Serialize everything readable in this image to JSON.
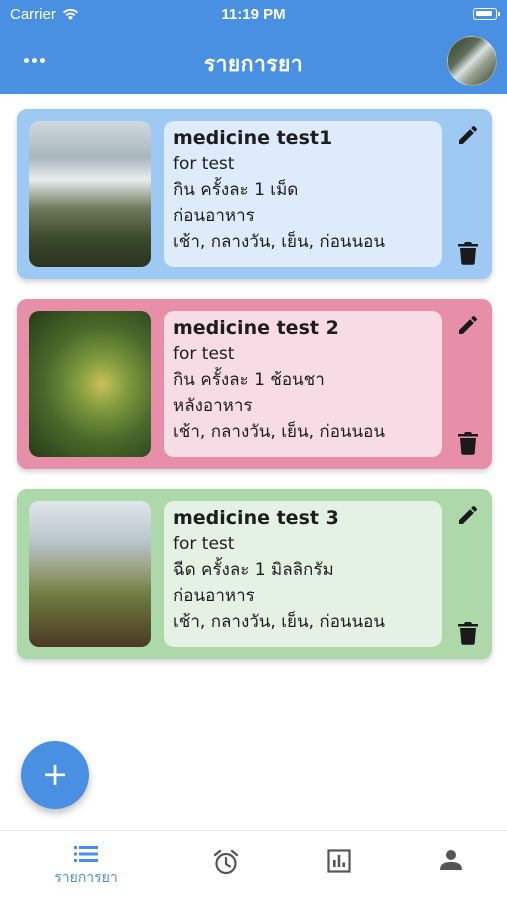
{
  "status_bar": {
    "carrier": "Carrier",
    "time": "11:19 PM"
  },
  "header": {
    "title": "รายการยา"
  },
  "medicines": [
    {
      "name": "medicine test1",
      "description": "for test",
      "dosage": "กิน ครั้งละ 1 เม็ด",
      "timing": "ก่อนอาหาร",
      "schedule": "เช้า, กลางวัน, เย็น, ก่อนนอน",
      "accent": "#9ec9f3"
    },
    {
      "name": "medicine test 2",
      "description": "for test",
      "dosage": "กิน ครั้งละ 1 ช้อนชา",
      "timing": "หลังอาหาร",
      "schedule": "เช้า, กลางวัน, เย็น, ก่อนนอน",
      "accent": "#e78ea8"
    },
    {
      "name": "medicine test 3",
      "description": "for test",
      "dosage": "ฉีด ครั้งละ 1 มิลลิกรัม",
      "timing": "ก่อนอาหาร",
      "schedule": "เช้า, กลางวัน, เย็น, ก่อนนอน",
      "accent": "#acd8aa"
    }
  ],
  "fab": {
    "icon": "plus-icon",
    "label": "+"
  },
  "bottom_nav": {
    "items": [
      {
        "icon": "list-icon",
        "label": "รายการยา",
        "active": true
      },
      {
        "icon": "alarm-icon",
        "label": "",
        "active": false
      },
      {
        "icon": "chart-icon",
        "label": "",
        "active": false
      },
      {
        "icon": "person-icon",
        "label": "",
        "active": false
      }
    ]
  },
  "colors": {
    "primary": "#4a90e2",
    "inactive_icon": "#555555"
  }
}
